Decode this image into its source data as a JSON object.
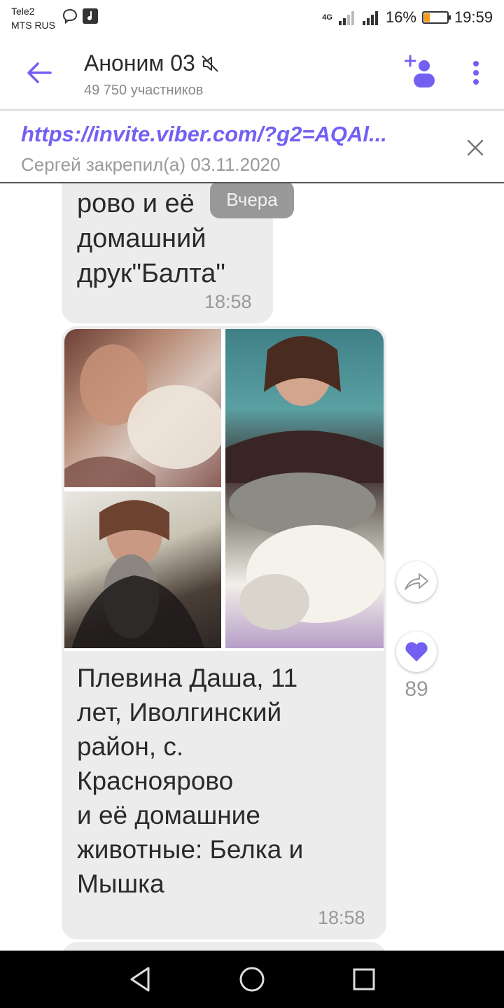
{
  "status_bar": {
    "carrier1": "Tele2",
    "carrier2": "MTS RUS",
    "network": "4G",
    "battery": "16%",
    "time": "19:59"
  },
  "header": {
    "title": "Аноним 03",
    "subtitle": "49 750 участников"
  },
  "pinned": {
    "link": "https://invite.viber.com/?g2=AQAl...",
    "meta": "Сергей закрепил(а) 03.11.2020"
  },
  "messages": [
    {
      "text_lines": [
        "рово и её",
        "домашний",
        "друк\"Балта\""
      ],
      "time": "18:58"
    },
    {
      "text_lines": [
        "Плевина Даша, 11",
        "лет, Иволгинский",
        "район, с.",
        "Краснoярово",
        "и её домашние",
        "животные: Белка и",
        "Мышка"
      ],
      "time": "18:58",
      "likes": "89"
    }
  ],
  "date_chip": "Вчера",
  "colors": {
    "accent": "#7360f2",
    "bubble": "#ececec"
  }
}
